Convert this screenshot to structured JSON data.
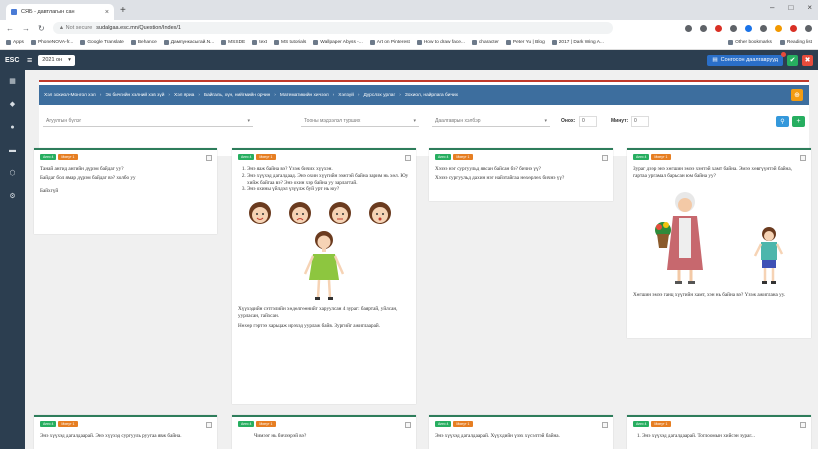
{
  "browser": {
    "tab_title": "СЯБ - давтлагын сан",
    "tab_close": "×",
    "new_tab": "+",
    "window_controls": [
      "–",
      "□",
      "×"
    ],
    "omnibox_warning": "▲ Not secure",
    "url": "sudalgaa.esc.mn/Question/Index/1",
    "bookmarks": [
      "Apps",
      "PhoneNOVA-fr...",
      "Google Translate",
      "Behance",
      "Дампункасыгай.N...",
      "MSSDE",
      "text",
      "MS tutorials",
      "Wallpaper Abyss -...",
      "Art on Pinterest",
      "How to draw face...",
      "character",
      "Peter Yu | Blog",
      "2017 | Dark Wing A..."
    ],
    "bookmarks_right": [
      "Other bookmarks",
      "Reading list"
    ]
  },
  "app": {
    "logo": "ESC",
    "menu_icon": "≡",
    "year": "2021 он",
    "year_caret": "▾",
    "list_button": "Сонгосон даалгаврууд",
    "ok_icon": "✔",
    "close_icon": "✖",
    "sidebar_icons": [
      "▦",
      "◆",
      "●",
      "▬",
      "⬡",
      "⚙"
    ]
  },
  "breadcrumb": {
    "items": [
      "Хэл зохиол-Монгол хэл",
      "Эх бичгийн хэлний хэв зүй",
      "Хэл яриа",
      "Байгаль, хүн, нийгмийн орчин",
      "Математикийн хичээл",
      "Хэлзүй",
      "Дүрслэх урлаг",
      "Зохиол, найрлага бичих"
    ],
    "separator": "›",
    "action_icon": "⊕"
  },
  "filters": {
    "author_placeholder": "Агуулгын бүлэг",
    "caret": "▾",
    "type_placeholder": "Тооны мэдээлэл турших",
    "task_placeholder": "Даалгаврын хэлбэр",
    "grade_label": "Онох:",
    "grade_value": "0",
    "minute_label": "Минут:",
    "minute_value": "0",
    "search_icon": "⚲",
    "add_icon": "+"
  },
  "cards": [
    {
      "tags": [
        "Анги 4",
        "Минут 1"
      ],
      "paragraphs": [
        "Танай ангид ангийн дүрэм байдаг уу?",
        "Байдаг бол ямар дүрэм байдаг вэ? холбо уу",
        "Байхгүй"
      ]
    },
    {
      "tags": [
        "Анги 4",
        "Минут 1"
      ],
      "list": [
        "Энэ яаж байна вэ? Үзэж бичих хүүхэн.",
        "Энэ хүүхэд дагалдаад. Энэ охин хүүгийн ээжтэй байна зарим нь хөл. Юу хийж байгаа вэ? Энэ охин хэр байна уу зарлагтай.",
        "Энэ охины үйлдэл үзүүлж буй урт нь юу?"
      ],
      "paragraphs": [
        "Хүүхэдийн сэтгэлийн хөдөлгөөнийг харуулсан 4 зураг: баяртай, уйлсан, уурласан, гайхсан.",
        "Нөхөр гэртээ харьцаж ирэхэд уурлаж байв. Зургийг ажиглаарай."
      ]
    },
    {
      "tags": [
        "Анги 4",
        "Минут 1"
      ],
      "paragraphs": [
        "Хэзээ нэг сургуульд явсан байсан бэ? бичнэ үү?",
        "Хэзээ сургуульд дахин нэг найзтайгаа нөхөрлөх бичнэ үү?"
      ]
    },
    {
      "tags": [
        "Анги 4",
        "Минут 1"
      ],
      "paragraphs": [
        "Зураг дээр энэ хөгшин эмээ хэнтэй хамт байна. Эмээ хөвгүүнтэй байна, гартаа ургамал барьсан юм байна уу?",
        "Хөгшин эмээ ганц хүүгийн хамт, хэн нь байна вэ? Үзэж ажиглана уу."
      ]
    },
    {
      "tags": [
        "Анги 4",
        "Минут 1"
      ],
      "paragraphs": [
        "Энэ хүүхэд дагалдаарай. Энэ хүүхэд сургууль руугаа явж байна."
      ]
    },
    {
      "tags": [
        "Анги 4",
        "Минут 1"
      ],
      "paragraphs": [
        "Чимээг нь бичээрэй вэ?"
      ]
    },
    {
      "tags": [
        "Анги 4",
        "Минут 1"
      ],
      "paragraphs": [
        "Энэ хүүхэд дагалдаарай. Хүүхдийн үзэх хүсэлтэй байна."
      ]
    },
    {
      "tags": [
        "Анги 4",
        "Минут 1"
      ],
      "list": [
        "Энэ хүүхэд дагалдаарай. Тоглоомын хийсэн зураг..."
      ]
    }
  ],
  "colors": {
    "appbar": "#2c3e50",
    "breadcrumb": "#3d6e9e",
    "card_border": "#2e7d5b",
    "accent_red": "#c0392b",
    "tag_green": "#27ae60",
    "tag_orange": "#e67e22"
  }
}
